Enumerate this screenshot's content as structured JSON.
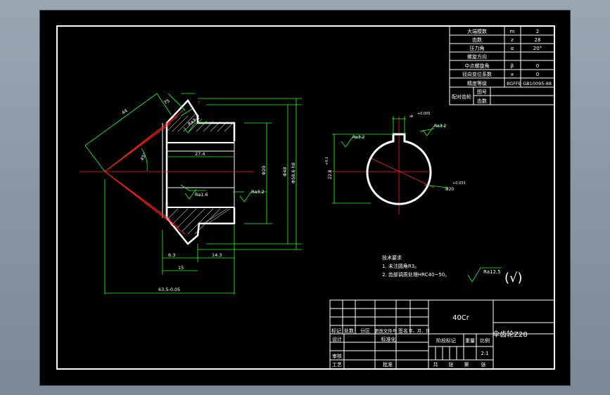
{
  "param_table": {
    "rows": [
      {
        "name": "大端模数",
        "sym": "m",
        "val": "2"
      },
      {
        "name": "齿数",
        "sym": "z",
        "val": "28"
      },
      {
        "name": "压力角",
        "sym": "α",
        "val": "20°"
      },
      {
        "name": "螺旋方向",
        "sym": "",
        "val": ""
      },
      {
        "name": "中点螺旋角",
        "sym": "β",
        "val": "0"
      },
      {
        "name": "径向变位系数",
        "sym": "x",
        "val": "0"
      },
      {
        "name": "精度等级",
        "sym": "",
        "val": "8GFFB GB10095-88"
      }
    ],
    "mate_label": "配对齿轮",
    "mate_rows": [
      "图号",
      "齿数"
    ]
  },
  "dims": {
    "d_44": "44",
    "d_75": "75",
    "d_45deg": "45°",
    "d_27_4": "27.4",
    "d_15": "15",
    "d_63": "63.5-0.05",
    "d_6_3": "6.3",
    "d_14_3": "14.3",
    "d_phi20": "Φ20",
    "d_phi48": "Φ48",
    "d_phi58": "Φ58.6 h8",
    "r_ra32a": "Ra3.2",
    "r_ra16": "Ra1.6",
    "r_ra32b": "Ra3.2",
    "r_ra32c": "Ra3.2",
    "r_ra32d": "Ra3.2",
    "d_keyway": "6",
    "d_keyway_tol": "+0.005",
    "d_hub": "22.8",
    "d_hub_tol": "+0.1",
    "d_bore": "Φ20",
    "d_bore_tol": "+0.033",
    "ra_general": "Ra12.5",
    "ra_general_paren": "(√)"
  },
  "notes": {
    "title": "技术要求",
    "items": [
      "1. 未注圆角R3。",
      "2. 齿部调质处理HRC40~50。"
    ]
  },
  "title_block": {
    "material": "40Cr",
    "part_name": "伞齿轮Z28",
    "labels": {
      "mark": "标记",
      "count": "处数",
      "zone": "分区",
      "change_doc": "更改文件号",
      "sign": "签名",
      "date": "年、月、日",
      "design": "设计",
      "standardize": "标准化",
      "check": "审核",
      "process": "工艺",
      "approve": "批准",
      "stage_mark": "阶段标记",
      "weight": "重量",
      "scale": "比例",
      "scale_val": "2:1",
      "sheet_total": "共",
      "sheet_unit": "张",
      "sheet_no": "第",
      "sheet_unit2": "张"
    }
  }
}
